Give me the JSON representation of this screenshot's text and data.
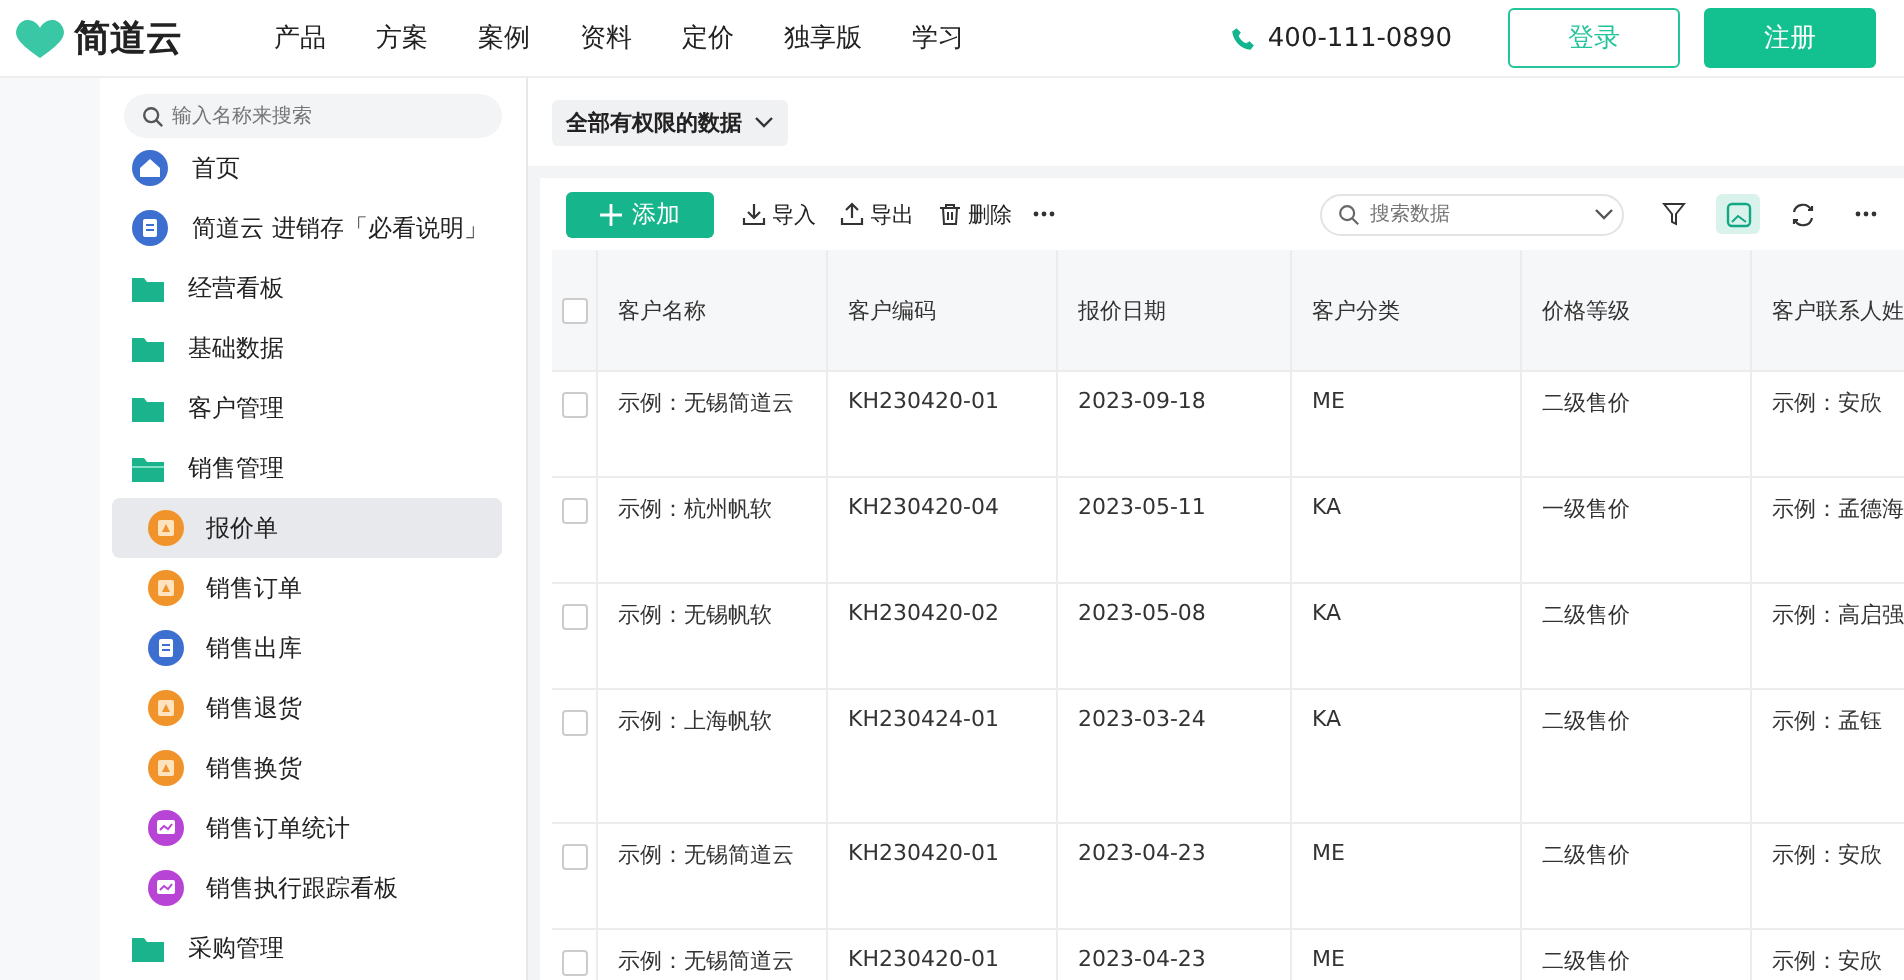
{
  "header": {
    "logo": "简道云",
    "nav": [
      "产品",
      "方案",
      "案例",
      "资料",
      "定价",
      "独享版",
      "学习"
    ],
    "phone": "400-111-0890",
    "login": "登录",
    "register": "注册"
  },
  "sidebar": {
    "search": {
      "placeholder": "输入名称来搜索"
    },
    "items": [
      {
        "label": "首页",
        "kind": "home"
      },
      {
        "label": "简道云 进销存「必看说明」",
        "kind": "doc"
      },
      {
        "label": "经营看板",
        "kind": "folder",
        "expanded": false
      },
      {
        "label": "基础数据",
        "kind": "folder",
        "expanded": false
      },
      {
        "label": "客户管理",
        "kind": "folder",
        "expanded": false
      },
      {
        "label": "销售管理",
        "kind": "folder",
        "expanded": true,
        "children": [
          {
            "label": "报价单",
            "kind": "form",
            "selected": true
          },
          {
            "label": "销售订单",
            "kind": "form",
            "selected": false
          },
          {
            "label": "销售出库",
            "kind": "doc",
            "selected": false
          },
          {
            "label": "销售退货",
            "kind": "form",
            "selected": false
          },
          {
            "label": "销售换货",
            "kind": "form",
            "selected": false
          },
          {
            "label": "销售订单统计",
            "kind": "chart",
            "selected": false
          },
          {
            "label": "销售执行跟踪看板",
            "kind": "chart",
            "selected": false
          }
        ]
      },
      {
        "label": "采购管理",
        "kind": "folder",
        "expanded": false
      }
    ]
  },
  "filter": {
    "label": "全部有权限的数据"
  },
  "toolbar": {
    "add": "添加",
    "actions": [
      {
        "label": "导入",
        "kind": "import"
      },
      {
        "label": "导出",
        "kind": "export"
      },
      {
        "label": "删除",
        "kind": "delete"
      }
    ],
    "search": {
      "placeholder": "搜索数据"
    },
    "tools": [
      {
        "kind": "filter",
        "selected": false
      },
      {
        "kind": "view",
        "selected": true
      },
      {
        "kind": "refresh",
        "selected": false
      },
      {
        "kind": "more",
        "selected": false
      }
    ]
  },
  "table": {
    "header_checked": false,
    "columns": [
      "客户名称",
      "客户编码",
      "报价日期",
      "客户分类",
      "价格等级",
      "客户联系人姓"
    ],
    "rows": [
      {
        "checked": false,
        "cells": [
          "示例：无锡简道云",
          "KH230420-01",
          "2023-09-18",
          "ME",
          "二级售价",
          "示例：安欣"
        ]
      },
      {
        "checked": false,
        "cells": [
          "示例：杭州帆软",
          "KH230420-04",
          "2023-05-11",
          "KA",
          "一级售价",
          "示例：孟德海"
        ]
      },
      {
        "checked": false,
        "cells": [
          "示例：无锡帆软",
          "KH230420-02",
          "2023-05-08",
          "KA",
          "二级售价",
          "示例：高启强"
        ]
      },
      {
        "checked": false,
        "cells": [
          "示例：上海帆软",
          "KH230424-01",
          "2023-03-24",
          "KA",
          "二级售价",
          "示例：孟钰"
        ]
      },
      {
        "checked": false,
        "cells": [
          "示例：无锡简道云",
          "KH230420-01",
          "2023-04-23",
          "ME",
          "二级售价",
          "示例：安欣"
        ]
      },
      {
        "checked": false,
        "cells": [
          "示例：无锡简道云",
          "KH230420-01",
          "2023-04-23",
          "ME",
          "二级售价",
          "示例：安欣"
        ]
      }
    ]
  }
}
